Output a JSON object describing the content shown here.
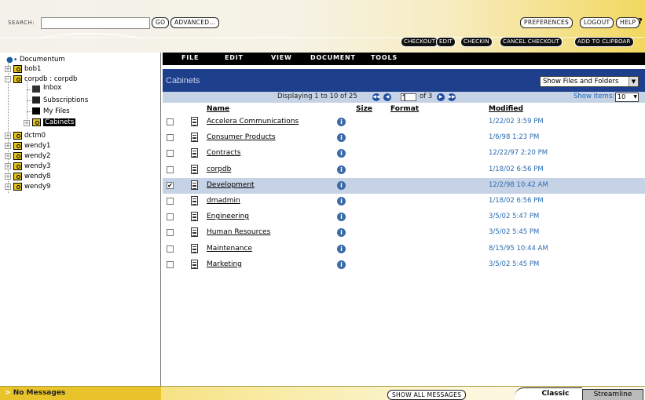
{
  "topbar": {
    "search_label": "SEARCH:",
    "search_value": "",
    "go": "GO",
    "advanced": "ADVANCED...",
    "preferences": "PREFERENCES",
    "logout": "LOGOUT",
    "help": "HELP"
  },
  "actions": {
    "checkout": "CHECKOUT",
    "edit": "EDIT",
    "checkin": "CHECKIN",
    "cancel_checkout": "CANCEL CHECKOUT",
    "add_to_clipboard": "ADD TO CLIPBOAR"
  },
  "menu": {
    "file": "FILE",
    "edit": "EDIT",
    "view": "VIEW",
    "document": "DOCUMENT",
    "tools": "TOOLS"
  },
  "tree": {
    "root": "Documentum",
    "bob1": "bob1",
    "corpdb": "corpdb : corpdb",
    "inbox": "Inbox",
    "subscriptions": "Subscriptions",
    "myfiles": "My Files",
    "cabinets": "Cabinets",
    "dctm0": "dctm0",
    "wendy1": "wendy1",
    "wendy2": "wendy2",
    "wendy3": "wendy3",
    "wendy8": "wendy8",
    "wendy9": "wendy9"
  },
  "main": {
    "title": "Cabinets",
    "show_select": "Show Files and Folders",
    "displaying": "Displaying 1 to 10 of 25",
    "page_value": "1",
    "of_pages": "of 3",
    "show_items_label": "Show items:",
    "show_items_value": "10",
    "columns": {
      "name": "Name",
      "size": "Size",
      "format": "Format",
      "modified": "Modified"
    },
    "rows": [
      {
        "name": "Accelera Communications",
        "modified": "1/22/02 3:59 PM",
        "checked": false
      },
      {
        "name": "Consumer Products",
        "modified": "1/6/98 1:23 PM",
        "checked": false
      },
      {
        "name": "Contracts",
        "modified": "12/22/97 2:20 PM",
        "checked": false
      },
      {
        "name": "corpdb",
        "modified": "1/18/02 6:56 PM",
        "checked": false
      },
      {
        "name": "Development",
        "modified": "12/2/98 10:42 AM",
        "checked": true
      },
      {
        "name": "dmadmin",
        "modified": "1/18/02 6:56 PM",
        "checked": false
      },
      {
        "name": "Engineering",
        "modified": "3/5/02 5:47 PM",
        "checked": false
      },
      {
        "name": "Human Resources",
        "modified": "3/5/02 5:45 PM",
        "checked": false
      },
      {
        "name": "Maintenance",
        "modified": "8/15/95 10:44 AM",
        "checked": false
      },
      {
        "name": "Marketing",
        "modified": "3/5/02 5:45 PM",
        "checked": false
      }
    ]
  },
  "bottom": {
    "messages": "No Messages",
    "show_all": "SHOW ALL MESSAGES",
    "tab_classic": "Classic",
    "tab_streamline": "Streamline"
  }
}
